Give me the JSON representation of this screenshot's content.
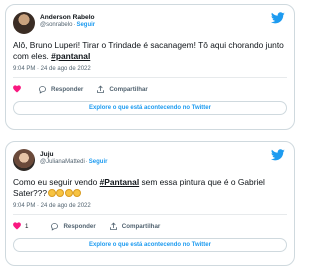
{
  "colors": {
    "accent": "#1d9bf0",
    "heart": "#f91880",
    "border": "#cfd9de",
    "muted": "#536471"
  },
  "tweets": [
    {
      "display_name": "Anderson Rabelo",
      "handle": "@sonrabelo",
      "follow_label": "Seguir",
      "text_before": "Alô, Bruno Luperi! Tirar o Trindade é sacanagem! Tô aqui chorando junto com eles. ",
      "hashtag": "#pantanal",
      "text_after": "",
      "emojis": [],
      "timestamp": "9:04 PM · 24 de ago de 2022",
      "like_count": "",
      "reply_label": "Responder",
      "share_label": "Compartilhar",
      "explore_label": "Explore o que está acontecendo no Twitter",
      "icons": {
        "heart": "heart-icon",
        "reply": "reply-icon",
        "share": "share-icon",
        "brand": "twitter-bird-icon"
      }
    },
    {
      "display_name": "Juju",
      "handle": "@JulianaMattedi",
      "follow_label": "Seguir",
      "text_before": "Como eu seguir vendo ",
      "hashtag": "#Pantanal",
      "text_after": " sem essa pintura que é o Gabriel Sater???",
      "emojis": [
        "crying-face",
        "crying-face",
        "crying-face",
        "crying-face"
      ],
      "timestamp": "9:04 PM · 24 de ago de 2022",
      "like_count": "1",
      "reply_label": "Responder",
      "share_label": "Compartilhar",
      "explore_label": "Explore o que está acontecendo no Twitter",
      "icons": {
        "heart": "heart-icon",
        "reply": "reply-icon",
        "share": "share-icon",
        "brand": "twitter-bird-icon"
      }
    }
  ]
}
